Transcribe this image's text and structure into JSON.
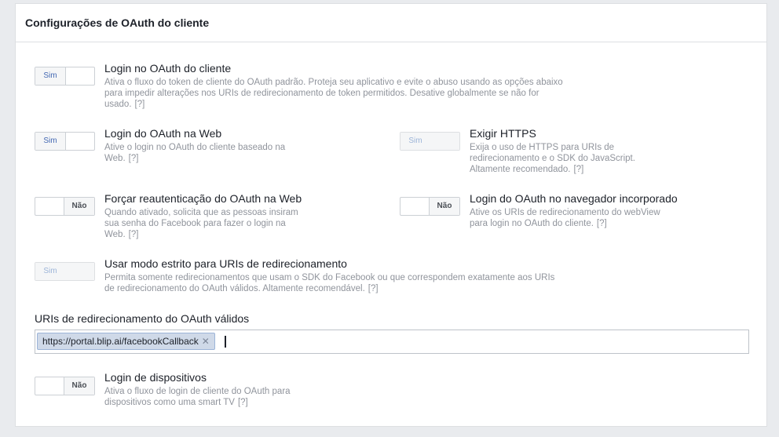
{
  "panel": {
    "title": "Configurações de OAuth do cliente"
  },
  "help_marker": "[?]",
  "toggle_labels": {
    "on": "Sim",
    "off": "Não"
  },
  "options": {
    "client_oauth_login": {
      "title": "Login no OAuth do cliente",
      "state": "on",
      "description": "Ativa o fluxo do token de cliente do OAuth padrão. Proteja seu aplicativo e evite o abuso usando as opções abaixo para impedir alterações nos URIs de redirecionamento de token permitidos. Desative globalmente se não for usado."
    },
    "web_oauth_login": {
      "title": "Login do OAuth na Web",
      "state": "on",
      "description": "Ative o login no OAuth do cliente baseado na Web."
    },
    "enforce_https": {
      "title": "Exigir HTTPS",
      "state": "on-disabled",
      "description": "Exija o uso de HTTPS para URIs de redirecionamento e o SDK do JavaScript. Altamente recomendado."
    },
    "force_web_reauth": {
      "title": "Forçar reautenticação do OAuth na Web",
      "state": "off",
      "description": "Quando ativado, solicita que as pessoas insiram sua senha do Facebook para fazer o login na Web."
    },
    "embedded_browser_login": {
      "title": "Login do OAuth no navegador incorporado",
      "state": "off",
      "description": "Ative os URIs de redirecionamento do webView para login no OAuth do cliente."
    },
    "strict_mode": {
      "title": "Usar modo estrito para URIs de redirecionamento",
      "state": "on-disabled",
      "description": "Permita somente redirecionamentos que usam o SDK do Facebook ou que correspondem exatamente aos URIs de redirecionamento do OAuth válidos. Altamente recomendável."
    },
    "device_login": {
      "title": "Login de dispositivos",
      "state": "off",
      "description": "Ativa o fluxo de login de cliente do OAuth para dispositivos como uma smart TV"
    }
  },
  "redirect_uris": {
    "label": "URIs de redirecionamento do OAuth válidos",
    "tokens": [
      "https://portal.blip.ai/facebookCallback"
    ],
    "remove_glyph": "✕"
  }
}
